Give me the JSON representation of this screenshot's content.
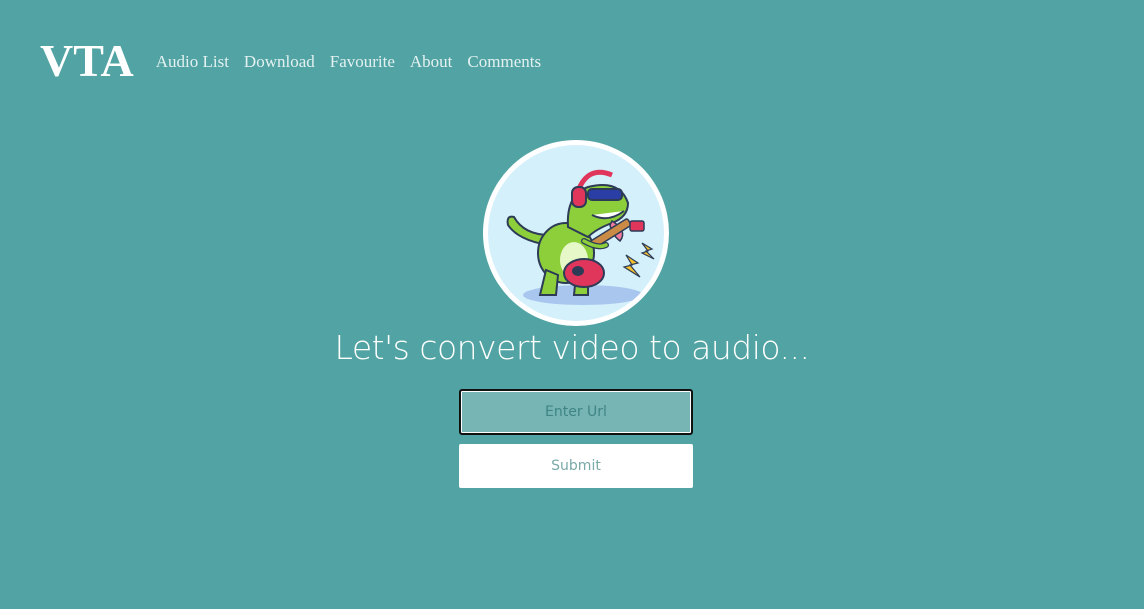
{
  "nav": {
    "logo": "VTA",
    "links": [
      "Audio List",
      "Download",
      "Favourite",
      "About",
      "Comments"
    ]
  },
  "hero": {
    "avatar_icon": "dinosaur-guitar-icon",
    "headline": "Let's convert video to audio..."
  },
  "form": {
    "url_placeholder": "Enter Url",
    "url_value": "",
    "submit_label": "Submit"
  },
  "colors": {
    "background": "#52a3a3",
    "input_bg": "#76b5b4",
    "avatar_bg": "#d4f0fb"
  }
}
